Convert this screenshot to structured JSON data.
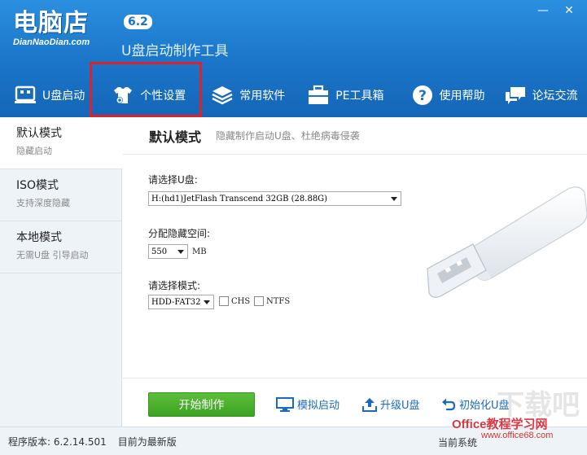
{
  "header": {
    "brand_name": "电脑店",
    "brand_version": "6.2",
    "brand_domain": "DianNaoDian.com",
    "brand_subtitle": "U盘启动制作工具",
    "minimize_label": "—",
    "close_label": "✕"
  },
  "nav": {
    "items": [
      {
        "label": "U盘启动",
        "icon": "usb-drive-icon"
      },
      {
        "label": "个性设置",
        "icon": "tshirt-gear-icon"
      },
      {
        "label": "常用软件",
        "icon": "stack-icon"
      },
      {
        "label": "PE工具箱",
        "icon": "toolbox-icon"
      },
      {
        "label": "使用帮助",
        "icon": "question-icon"
      },
      {
        "label": "论坛交流",
        "icon": "chat-icon"
      }
    ]
  },
  "sidebar": {
    "items": [
      {
        "title": "默认模式",
        "desc": "隐藏启动",
        "active": true
      },
      {
        "title": "ISO模式",
        "desc": "支持深度隐藏",
        "active": false
      },
      {
        "title": "本地模式",
        "desc": "无需U盘 引导启动",
        "active": false
      }
    ]
  },
  "main": {
    "title": "默认模式",
    "subtitle": "隐藏制作启动U盘、杜绝病毒侵袭",
    "select_disk_label": "请选择U盘:",
    "select_disk_value": "H:(hd1)JetFlash Transcend 32GB (28.88G)",
    "hidden_space_label": "分配隐藏空间:",
    "hidden_space_value": "550",
    "hidden_space_unit": "MB",
    "mode_label": "请选择模式:",
    "mode_value": "HDD-FAT32",
    "chs_label": "CHS",
    "ntfs_label": "NTFS",
    "start_button": "开始制作",
    "simulate_label": "模拟启动",
    "upgrade_label": "升级U盘",
    "init_label": "初始化U盘"
  },
  "status": {
    "version_text": "程序版本: 6.2.14.501",
    "update_text": "目前为最新版",
    "right_text": "当前系统"
  },
  "watermark": {
    "text": "Office教程学习网",
    "domain": "www.office68.com",
    "big": "下载吧"
  },
  "colors": {
    "header_blue": "#1a74c8",
    "highlight_red": "#d9232e",
    "start_green": "#4cb12e",
    "link_blue": "#1a6bc0"
  }
}
